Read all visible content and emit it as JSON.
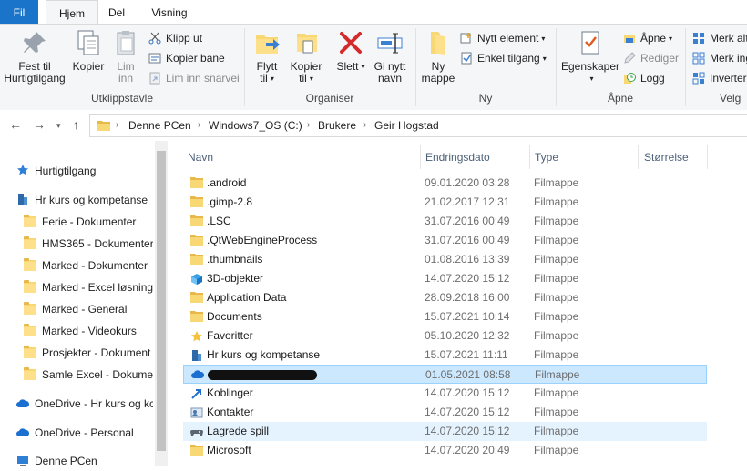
{
  "ribbon": {
    "tabs": [
      "Fil",
      "Hjem",
      "Del",
      "Visning"
    ],
    "clipboard": {
      "pin_label": [
        "Fest til",
        "Hurtigtilgang"
      ],
      "copy_label": "Kopier",
      "paste_label": [
        "Lim",
        "inn"
      ],
      "cut_label": "Klipp ut",
      "copy_path_label": "Kopier bane",
      "paste_shortcut_label": "Lim inn snarvei",
      "group_label": "Utklippstavle"
    },
    "organize": {
      "move_label": [
        "Flytt",
        "til"
      ],
      "copyto_label": [
        "Kopier",
        "til"
      ],
      "delete_label": "Slett",
      "rename_label": [
        "Gi nytt",
        "navn"
      ],
      "group_label": "Organiser"
    },
    "new": {
      "new_folder_label": [
        "Ny",
        "mappe"
      ],
      "new_item_label": "Nytt element",
      "easy_access_label": "Enkel tilgang",
      "group_label": "Ny"
    },
    "open": {
      "properties_label": "Egenskaper",
      "open_label": "Åpne",
      "edit_label": "Rediger",
      "history_label": "Logg",
      "group_label": "Åpne"
    },
    "select": {
      "select_all_label": "Merk alt",
      "select_none_label": "Merk ing",
      "invert_label": "Inverter",
      "group_label": "Velg"
    }
  },
  "address": {
    "crumbs": [
      "Denne PCen",
      "Windows7_OS (C:)",
      "Brukere",
      "Geir Hogstad"
    ]
  },
  "navpane": {
    "items": [
      {
        "label": "Hurtigtilgang",
        "icon": "star-icon"
      },
      {
        "label": "Hr kurs og kompetanse",
        "icon": "building-icon"
      },
      {
        "label": "Ferie - Dokumenter",
        "icon": "folder-icon"
      },
      {
        "label": "HMS365 - Dokumenter",
        "icon": "folder-icon"
      },
      {
        "label": "Marked - Dokumenter",
        "icon": "folder-icon"
      },
      {
        "label": "Marked - Excel løsning",
        "icon": "folder-icon"
      },
      {
        "label": "Marked - General",
        "icon": "folder-icon"
      },
      {
        "label": "Marked - Videokurs",
        "icon": "folder-icon"
      },
      {
        "label": "Prosjekter - Dokument",
        "icon": "folder-icon"
      },
      {
        "label": "Samle Excel - Dokumer",
        "icon": "folder-icon"
      },
      {
        "label": "OneDrive - Hr kurs og kc",
        "icon": "cloud-icon"
      },
      {
        "label": "OneDrive - Personal",
        "icon": "cloud-icon"
      },
      {
        "label": "Denne PCen",
        "icon": "computer-icon"
      }
    ]
  },
  "columns": {
    "name": "Navn",
    "date": "Endringsdato",
    "type": "Type",
    "size": "Størrelse"
  },
  "files": [
    {
      "name": ".android",
      "date": "09.01.2020 03:28",
      "type": "Filmappe",
      "icon": "folder-icon"
    },
    {
      "name": ".gimp-2.8",
      "date": "21.02.2017 12:31",
      "type": "Filmappe",
      "icon": "folder-icon"
    },
    {
      "name": ".LSC",
      "date": "31.07.2016 00:49",
      "type": "Filmappe",
      "icon": "folder-icon"
    },
    {
      "name": ".QtWebEngineProcess",
      "date": "31.07.2016 00:49",
      "type": "Filmappe",
      "icon": "folder-icon"
    },
    {
      "name": ".thumbnails",
      "date": "01.08.2016 13:39",
      "type": "Filmappe",
      "icon": "folder-icon"
    },
    {
      "name": "3D-objekter",
      "date": "14.07.2020 15:12",
      "type": "Filmappe",
      "icon": "cube-icon"
    },
    {
      "name": "Application Data",
      "date": "28.09.2018 16:00",
      "type": "Filmappe",
      "icon": "folder-icon"
    },
    {
      "name": "Documents",
      "date": "15.07.2021 10:14",
      "type": "Filmappe",
      "icon": "folder-icon"
    },
    {
      "name": "Favoritter",
      "date": "05.10.2020 12:32",
      "type": "Filmappe",
      "icon": "star-icon"
    },
    {
      "name": "Hr kurs og kompetanse",
      "date": "15.07.2021 11:11",
      "type": "Filmappe",
      "icon": "building-icon"
    },
    {
      "name": "",
      "date": "01.05.2021 08:58",
      "type": "Filmappe",
      "icon": "cloud-icon"
    },
    {
      "name": "Koblinger",
      "date": "14.07.2020 15:12",
      "type": "Filmappe",
      "icon": "link-icon"
    },
    {
      "name": "Kontakter",
      "date": "14.07.2020 15:12",
      "type": "Filmappe",
      "icon": "contacts-icon"
    },
    {
      "name": "Lagrede spill",
      "date": "14.07.2020 15:12",
      "type": "Filmappe",
      "icon": "gamepad-icon"
    },
    {
      "name": "Microsoft",
      "date": "14.07.2020 20:49",
      "type": "Filmappe",
      "icon": "folder-icon"
    }
  ],
  "colors": {
    "accent": "#1a74c9",
    "selected_bg": "#cce8ff",
    "hover_bg": "#e5f3ff",
    "folder": "#f8d775"
  }
}
